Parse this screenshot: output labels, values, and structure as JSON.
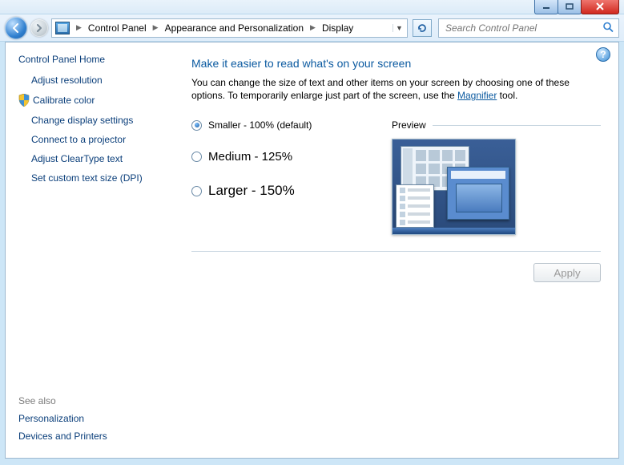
{
  "window": {
    "min_label": "Minimize",
    "max_label": "Maximize",
    "close_label": "Close"
  },
  "breadcrumb": {
    "items": [
      "Control Panel",
      "Appearance and Personalization",
      "Display"
    ]
  },
  "search": {
    "placeholder": "Search Control Panel"
  },
  "sidebar": {
    "home": "Control Panel Home",
    "links": [
      "Adjust resolution",
      "Calibrate color",
      "Change display settings",
      "Connect to a projector",
      "Adjust ClearType text",
      "Set custom text size (DPI)"
    ],
    "shielded_index": 1,
    "see_also_label": "See also",
    "see_also": [
      "Personalization",
      "Devices and Printers"
    ]
  },
  "main": {
    "heading": "Make it easier to read what's on your screen",
    "desc_pre": "You can change the size of text and other items on your screen by choosing one of these options. To temporarily enlarge just part of the screen, use the ",
    "desc_link": "Magnifier",
    "desc_post": " tool.",
    "options": [
      {
        "label": "Smaller - 100% (default)",
        "selected": true,
        "scale": "normal"
      },
      {
        "label": "Medium - 125%",
        "selected": false,
        "scale": "big1"
      },
      {
        "label": "Larger - 150%",
        "selected": false,
        "scale": "big2"
      }
    ],
    "preview_label": "Preview",
    "apply_label": "Apply",
    "apply_enabled": false
  },
  "help_tooltip": "Help"
}
